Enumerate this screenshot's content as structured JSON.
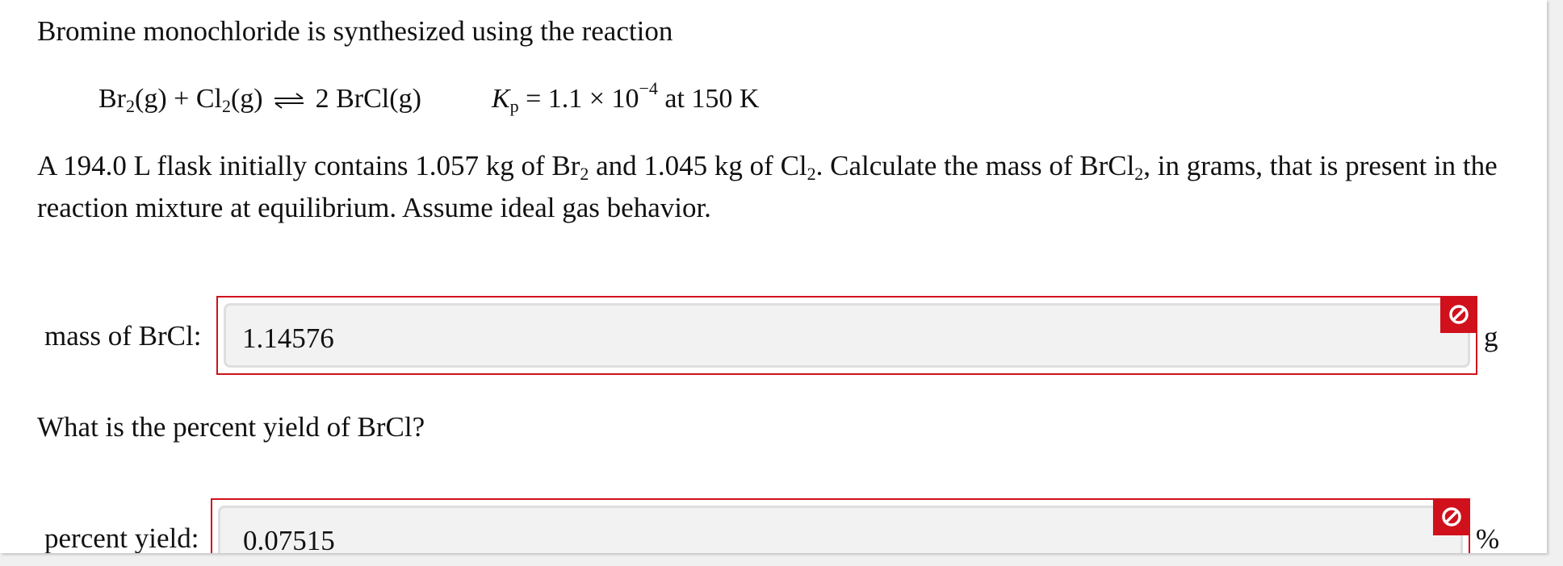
{
  "question": {
    "intro": "Bromine monochloride is synthesized using the reaction",
    "equation": {
      "reactant1_base": "Br",
      "reactant1_sub": "2",
      "reactant1_state": "(g)",
      "plus": "+",
      "reactant2_base": "Cl",
      "reactant2_sub": "2",
      "reactant2_state": "(g)",
      "product": "2 BrCl(g)",
      "kp_symbol": "K",
      "kp_sub": "p",
      "kp_value": "= 1.1 × 10",
      "kp_exponent": "−4",
      "kp_condition": "at 150 K"
    },
    "problem": {
      "part1": "A 194.0 L flask initially contains 1.057 kg of Br",
      "sub1": "2",
      "part2": " and 1.045 kg of Cl",
      "sub2": "2",
      "part3": ". Calculate the mass of BrCl",
      "sub3": "2",
      "part4": ", in grams, that is present in the reaction mixture at equilibrium. Assume ideal gas behavior."
    },
    "followup": "What is the percent yield of BrCl?"
  },
  "answers": {
    "mass": {
      "label": "mass of BrCl:",
      "value": "1.14576",
      "unit": "g",
      "status": "incorrect"
    },
    "yield": {
      "label": "percent yield:",
      "value": "0.07515",
      "unit": "%",
      "status": "incorrect"
    }
  },
  "colors": {
    "error": "#d0111b",
    "field_background": "#f2f2f2"
  },
  "icons": {
    "status": "incorrect-icon"
  }
}
